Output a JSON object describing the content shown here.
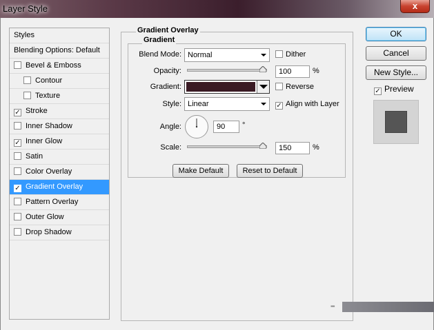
{
  "window": {
    "title": "Layer Style",
    "close_glyph": "x"
  },
  "styles_list": {
    "header": "Styles",
    "items": [
      {
        "label": "Blending Options: Default",
        "has_checkbox": false,
        "checked": false,
        "indent": false,
        "selected": false
      },
      {
        "label": "Bevel & Emboss",
        "has_checkbox": true,
        "checked": false,
        "indent": false,
        "selected": false
      },
      {
        "label": "Contour",
        "has_checkbox": true,
        "checked": false,
        "indent": true,
        "selected": false
      },
      {
        "label": "Texture",
        "has_checkbox": true,
        "checked": false,
        "indent": true,
        "selected": false
      },
      {
        "label": "Stroke",
        "has_checkbox": true,
        "checked": true,
        "indent": false,
        "selected": false
      },
      {
        "label": "Inner Shadow",
        "has_checkbox": true,
        "checked": false,
        "indent": false,
        "selected": false
      },
      {
        "label": "Inner Glow",
        "has_checkbox": true,
        "checked": true,
        "indent": false,
        "selected": false
      },
      {
        "label": "Satin",
        "has_checkbox": true,
        "checked": false,
        "indent": false,
        "selected": false
      },
      {
        "label": "Color Overlay",
        "has_checkbox": true,
        "checked": false,
        "indent": false,
        "selected": false
      },
      {
        "label": "Gradient Overlay",
        "has_checkbox": true,
        "checked": true,
        "indent": false,
        "selected": true
      },
      {
        "label": "Pattern Overlay",
        "has_checkbox": true,
        "checked": false,
        "indent": false,
        "selected": false
      },
      {
        "label": "Outer Glow",
        "has_checkbox": true,
        "checked": false,
        "indent": false,
        "selected": false
      },
      {
        "label": "Drop Shadow",
        "has_checkbox": true,
        "checked": false,
        "indent": false,
        "selected": false
      }
    ]
  },
  "panel": {
    "title": "Gradient Overlay",
    "subtitle": "Gradient",
    "blend_mode": {
      "label": "Blend Mode:",
      "value": "Normal"
    },
    "dither": {
      "label": "Dither",
      "checked": false
    },
    "opacity": {
      "label": "Opacity:",
      "value": "100",
      "unit": "%",
      "fraction": 1.0
    },
    "gradient": {
      "label": "Gradient:",
      "color": "#3a1a24"
    },
    "reverse": {
      "label": "Reverse",
      "checked": false
    },
    "style": {
      "label": "Style:",
      "value": "Linear"
    },
    "align_with_layer": {
      "label": "Align with Layer",
      "checked": true
    },
    "angle": {
      "label": "Angle:",
      "value": "90",
      "unit": "°"
    },
    "scale": {
      "label": "Scale:",
      "value": "150",
      "unit": "%",
      "fraction": 1.0
    },
    "make_default": "Make Default",
    "reset_default": "Reset to Default"
  },
  "right_panel": {
    "ok": "OK",
    "cancel": "Cancel",
    "new_style": "New Style...",
    "preview": {
      "label": "Preview",
      "checked": true
    }
  },
  "check_glyph": "✓",
  "colors": {
    "selection": "#3399ff",
    "preview_swatch": "#555555"
  }
}
